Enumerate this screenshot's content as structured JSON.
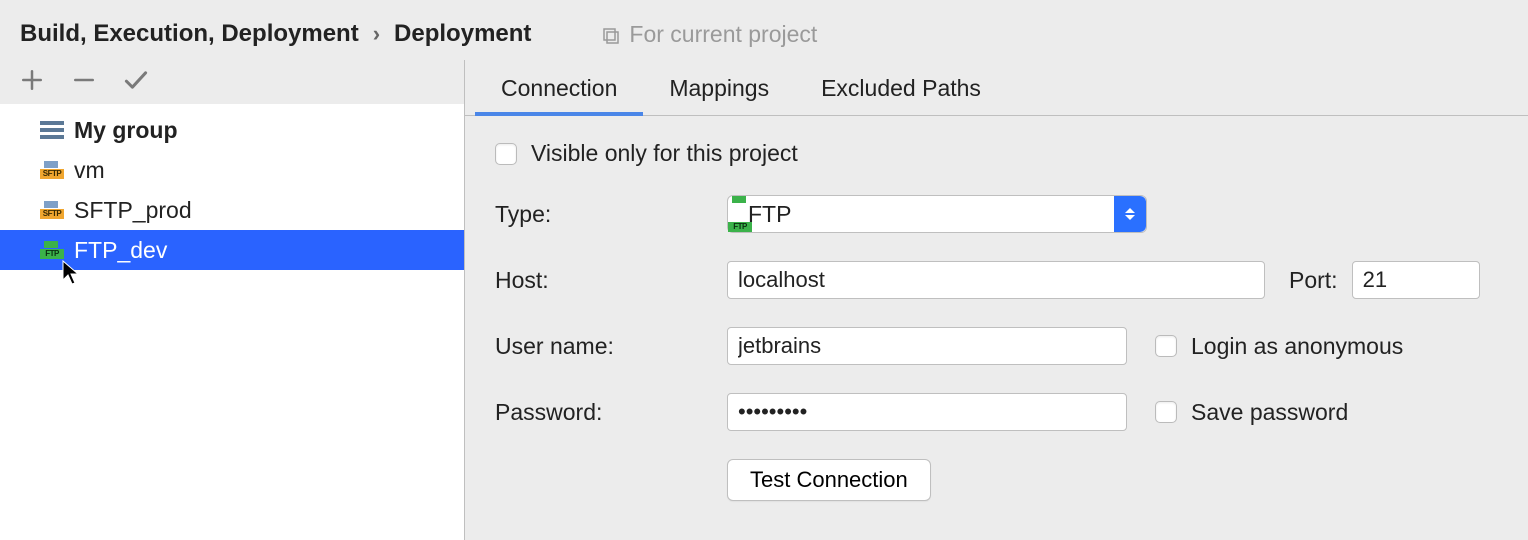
{
  "breadcrumb": {
    "parent": "Build, Execution, Deployment",
    "current": "Deployment",
    "scope_hint": "For current project"
  },
  "tree": {
    "group_label": "My group",
    "items": [
      {
        "label": "vm",
        "proto": "SFTP"
      },
      {
        "label": "SFTP_prod",
        "proto": "SFTP"
      },
      {
        "label": "FTP_dev",
        "proto": "FTP",
        "selected": true
      }
    ]
  },
  "tabs": {
    "connection": "Connection",
    "mappings": "Mappings",
    "excluded": "Excluded Paths",
    "active": "connection"
  },
  "form": {
    "visible_only_label": "Visible only for this project",
    "visible_only_checked": false,
    "type_label": "Type:",
    "type_value": "FTP",
    "host_label": "Host:",
    "host_value": "localhost",
    "port_label": "Port:",
    "port_value": "21",
    "user_label": "User name:",
    "user_value": "jetbrains",
    "login_anon_label": "Login as anonymous",
    "login_anon_checked": false,
    "password_label": "Password:",
    "password_value": "•••••••••",
    "save_password_label": "Save password",
    "save_password_checked": false,
    "test_connection_label": "Test Connection"
  },
  "colors": {
    "selection": "#2a63ff",
    "tab_underline": "#4a86e8"
  }
}
